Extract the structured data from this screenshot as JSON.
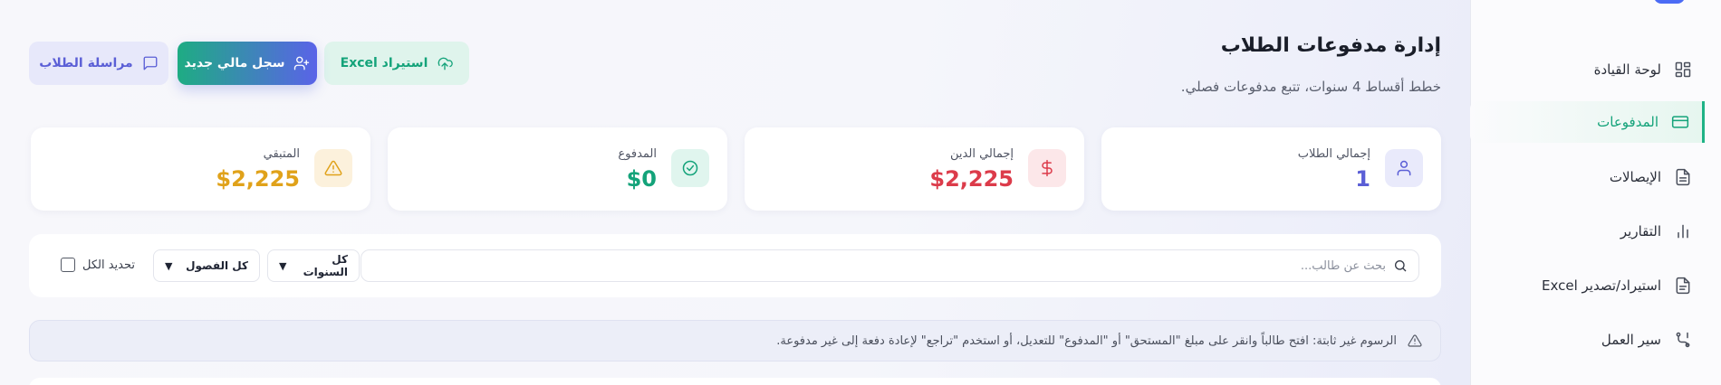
{
  "sidebar": {
    "items": [
      {
        "label": "لوحة القيادة",
        "icon": "dashboard-icon",
        "active": false
      },
      {
        "label": "المدفوعات",
        "icon": "credit-card-icon",
        "active": true
      },
      {
        "label": "الإيصالات",
        "icon": "document-icon",
        "active": false
      },
      {
        "label": "التقارير",
        "icon": "bar-chart-icon",
        "active": false
      },
      {
        "label": "استيراد/تصدير Excel",
        "icon": "file-icon",
        "active": false
      },
      {
        "label": "سير العمل",
        "icon": "workflow-icon",
        "active": false
      }
    ]
  },
  "header": {
    "title": "إدارة مدفوعات الطلاب",
    "subtitle": "خطط أقساط 4 سنوات، تتبع مدفوعات فصلي."
  },
  "toolbar": {
    "import_label": "استيراد Excel",
    "new_record_label": "سجل مالي جديد",
    "message_label": "مراسلة الطلاب"
  },
  "stats": [
    {
      "label": "إجمالي الطلاب",
      "value": "1",
      "color": "#5b5fd6",
      "icon": "user-icon"
    },
    {
      "label": "إجمالي الدين",
      "value": "$2,225",
      "color": "#dc3b4a",
      "icon": "dollar-icon"
    },
    {
      "label": "المدفوع",
      "value": "$0",
      "color": "#14a37a",
      "icon": "check-circle-icon"
    },
    {
      "label": "المتبقي",
      "value": "$2,225",
      "color": "#e0a21a",
      "icon": "warning-icon"
    }
  ],
  "filters": {
    "search_placeholder": "بحث عن طالب...",
    "years_selected": "كل السنوات",
    "terms_selected": "كل الفصول",
    "select_all_label": "تحديد الكل"
  },
  "notice": {
    "text": "الرسوم غير ثابتة: افتح طالباً وانقر على مبلغ \"المستحق\" أو \"المدفوع\" للتعديل، أو استخدم \"تراجع\" لإعادة دفعة إلى غير مدفوعة."
  },
  "colors": {
    "accent_green": "#14a37a",
    "accent_indigo": "#5b5fd6",
    "danger": "#dc3b4a",
    "warning": "#e0a21a"
  }
}
